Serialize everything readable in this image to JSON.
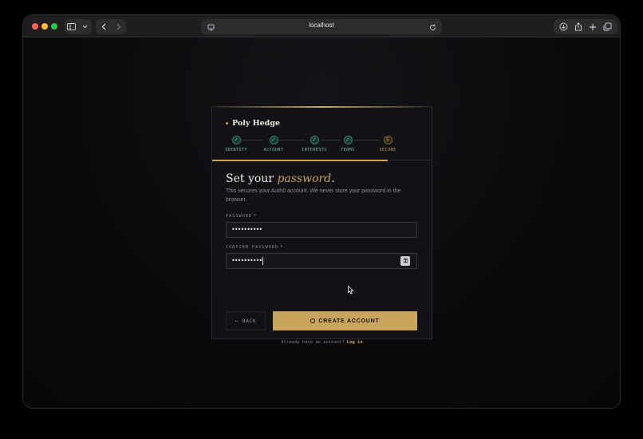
{
  "browser": {
    "url": "localhost"
  },
  "app": {
    "brand": "Poly Hedge"
  },
  "steps": [
    {
      "label": "IDENTITY",
      "marker": "✓",
      "state": "done"
    },
    {
      "label": "ACCOUNT",
      "marker": "✓",
      "state": "done"
    },
    {
      "label": "INTERESTS",
      "marker": "✓",
      "state": "done"
    },
    {
      "label": "TERMS",
      "marker": "✓",
      "state": "done"
    },
    {
      "label": "SECURE",
      "marker": "5",
      "state": "current"
    }
  ],
  "progress": 0.8,
  "form": {
    "heading_prefix": "Set your ",
    "heading_emphasis": "password",
    "heading_suffix": ".",
    "subtext": "This secures your Auth0 account. We never store your password in the browser.",
    "password_label": "PASSWORD",
    "password_value": "••••••••••",
    "confirm_label": "CONFIRM PASSWORD",
    "confirm_value": "••••••••••",
    "required_mark": "*",
    "key_badge": "⚿"
  },
  "actions": {
    "back_label": "← BACK",
    "create_label": "CREATE ACCOUNT"
  },
  "footer": {
    "prompt": "Already have an account?",
    "login_link": "Log in"
  },
  "colors": {
    "accent": "#c8a45c",
    "done": "#6fc8b2",
    "background": "#0a0a0c"
  }
}
